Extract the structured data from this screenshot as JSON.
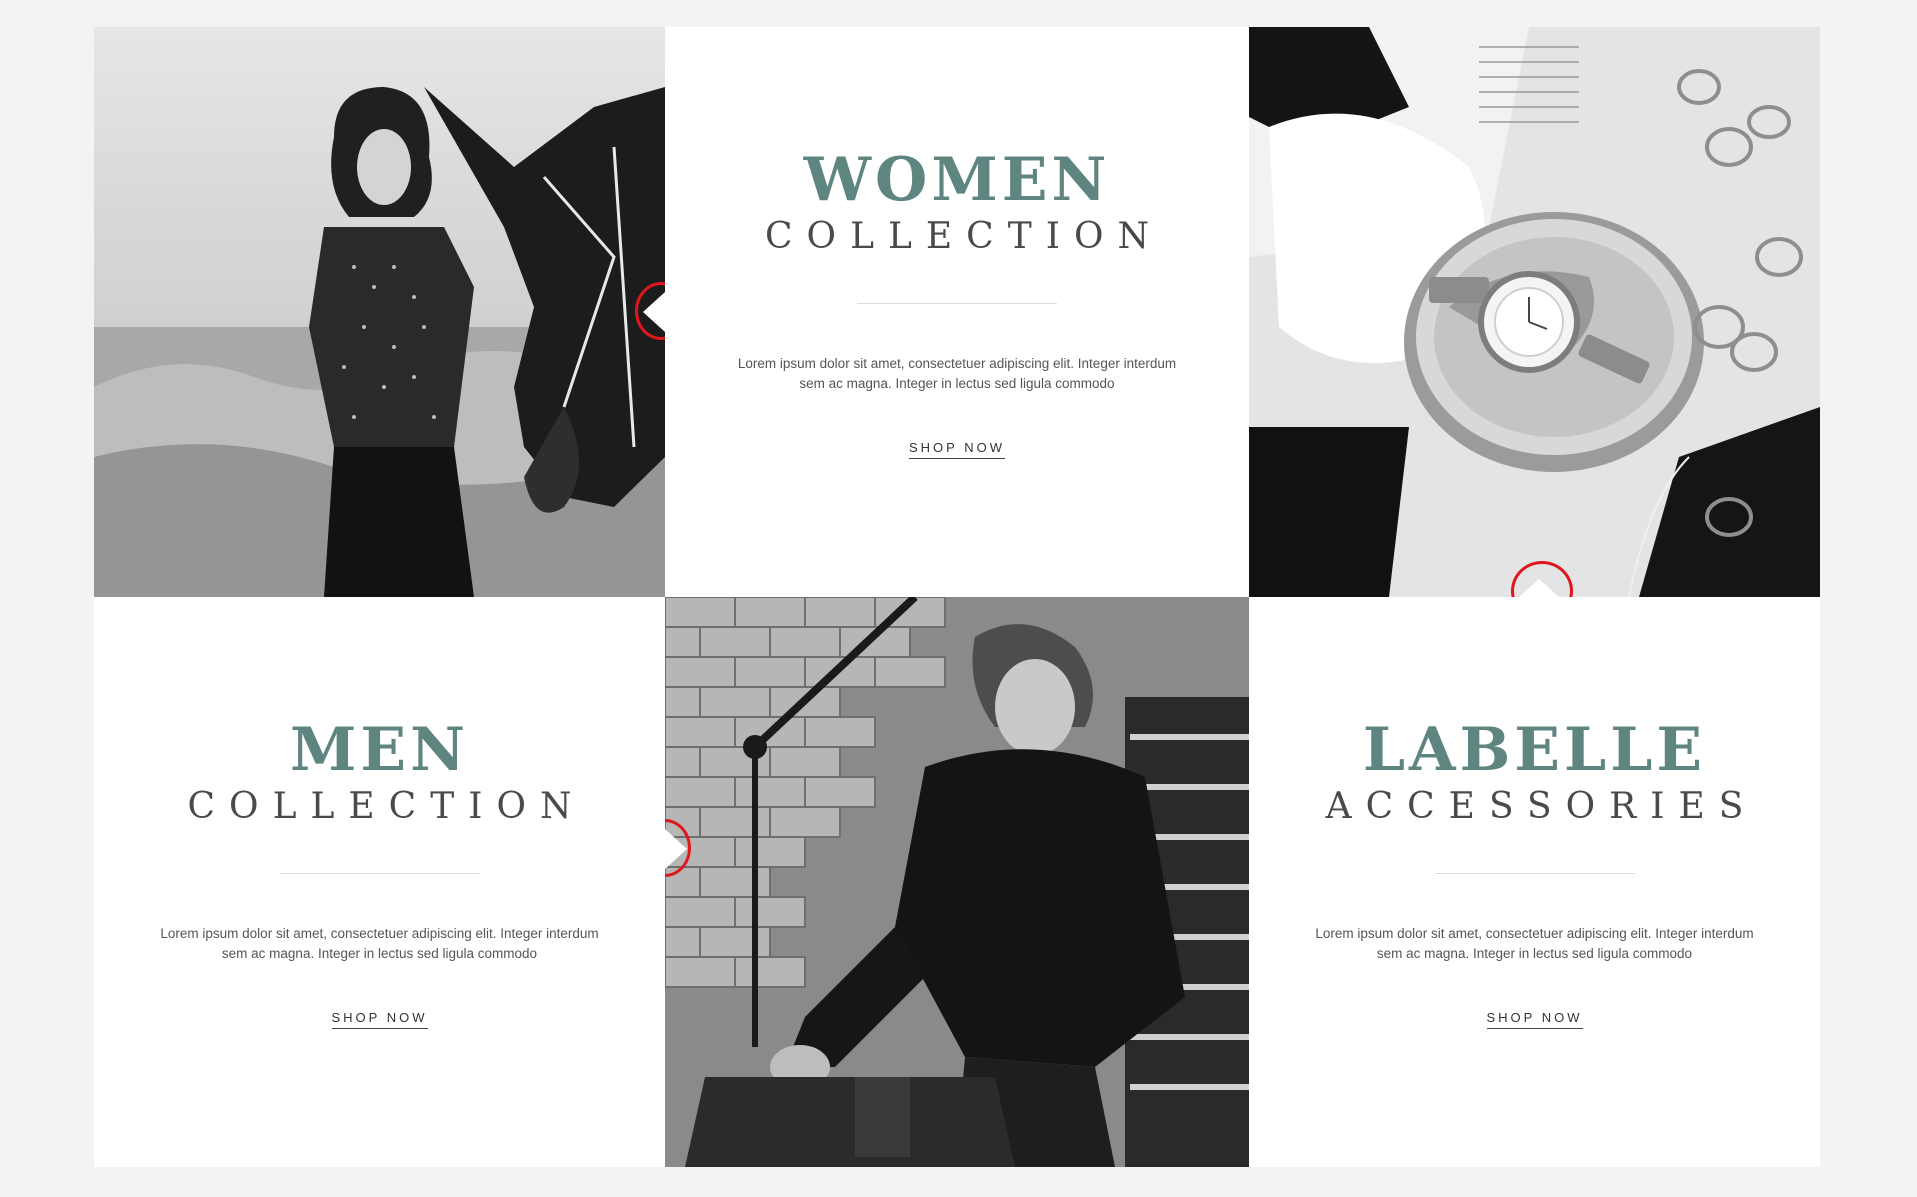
{
  "women": {
    "title": "WOMEN",
    "subtitle": "COLLECTION",
    "description": "Lorem ipsum dolor sit amet, consectetuer adipiscing elit. Integer interdum sem ac magna. Integer in lectus sed ligula commodo",
    "cta": "SHOP NOW"
  },
  "men": {
    "title": "MEN",
    "subtitle": "COLLECTION",
    "description": "Lorem ipsum dolor sit amet, consectetuer adipiscing elit. Integer interdum sem ac magna. Integer in lectus sed ligula commodo",
    "cta": "SHOP NOW"
  },
  "accessories": {
    "title": "LABELLE",
    "subtitle": "ACCESSORIES",
    "description": "Lorem ipsum dolor sit amet, consectetuer adipiscing elit. Integer interdum sem ac magna. Integer in lectus sed ligula commodo",
    "cta": "SHOP NOW"
  },
  "colors": {
    "accent": "#5f8580",
    "subtitle": "#4a4a4a",
    "highlight_ring": "#e0161c",
    "page_background": "#f3f3f3"
  }
}
